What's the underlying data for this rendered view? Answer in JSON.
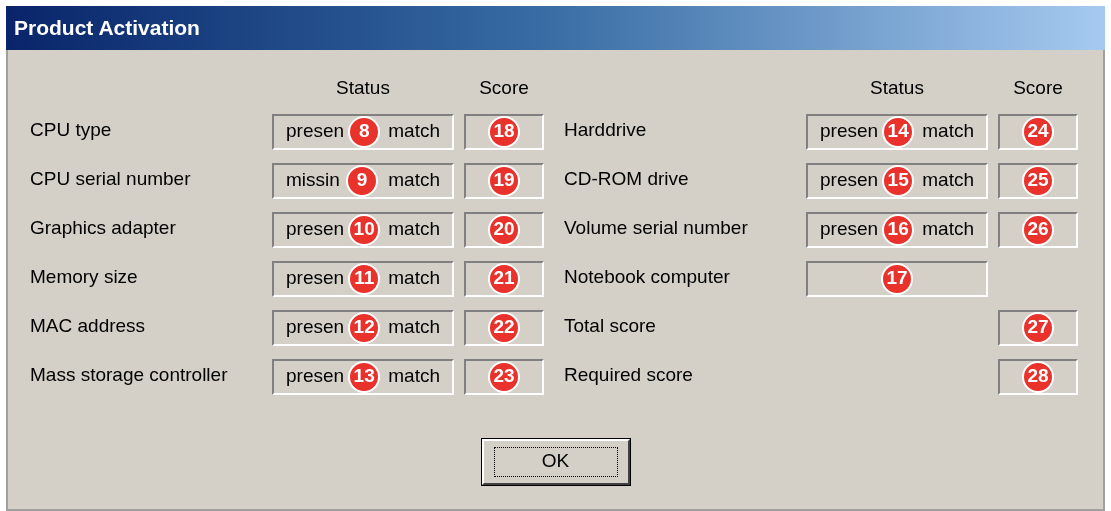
{
  "window": {
    "title": "Product Activation"
  },
  "columns": [
    {
      "headers": {
        "status": "Status",
        "score": "Score"
      },
      "rows": [
        {
          "kind": "status_score",
          "label": "CPU type",
          "status": {
            "text_before": "presen",
            "callout": "8",
            "text_after": "match"
          },
          "score": {
            "callout": "18"
          }
        },
        {
          "kind": "status_score",
          "label": "CPU serial number",
          "status": {
            "text_before": "missin",
            "callout": "9",
            "text_after": "match"
          },
          "score": {
            "callout": "19"
          }
        },
        {
          "kind": "status_score",
          "label": "Graphics adapter",
          "status": {
            "text_before": "presen",
            "callout": "10",
            "text_after": "match"
          },
          "score": {
            "callout": "20"
          }
        },
        {
          "kind": "status_score",
          "label": "Memory size",
          "status": {
            "text_before": "presen",
            "callout": "11",
            "text_after": "match"
          },
          "score": {
            "callout": "21"
          }
        },
        {
          "kind": "status_score",
          "label": "MAC address",
          "status": {
            "text_before": "presen",
            "callout": "12",
            "text_after": "match"
          },
          "score": {
            "callout": "22"
          }
        },
        {
          "kind": "status_score",
          "label": "Mass storage controller",
          "status": {
            "text_before": "presen",
            "callout": "13",
            "text_after": "match"
          },
          "score": {
            "callout": "23"
          }
        }
      ]
    },
    {
      "headers": {
        "status": "Status",
        "score": "Score"
      },
      "rows": [
        {
          "kind": "status_score",
          "label": "Harddrive",
          "status": {
            "text_before": "presen",
            "callout": "14",
            "text_after": "match"
          },
          "score": {
            "callout": "24"
          }
        },
        {
          "kind": "status_score",
          "label": "CD-ROM drive",
          "status": {
            "text_before": "presen",
            "callout": "15",
            "text_after": "match"
          },
          "score": {
            "callout": "25"
          }
        },
        {
          "kind": "status_score",
          "label": "Volume serial number",
          "status": {
            "text_before": "presen",
            "callout": "16",
            "text_after": "match"
          },
          "score": {
            "callout": "26"
          }
        },
        {
          "kind": "status_only",
          "label": "Notebook computer",
          "status": {
            "callout": "17"
          }
        },
        {
          "kind": "score_only",
          "label": "Total score",
          "score": {
            "callout": "27"
          }
        },
        {
          "kind": "score_only",
          "label": "Required score",
          "score": {
            "callout": "28"
          }
        }
      ]
    }
  ],
  "buttons": [
    {
      "label": "OK",
      "focused": true
    }
  ]
}
